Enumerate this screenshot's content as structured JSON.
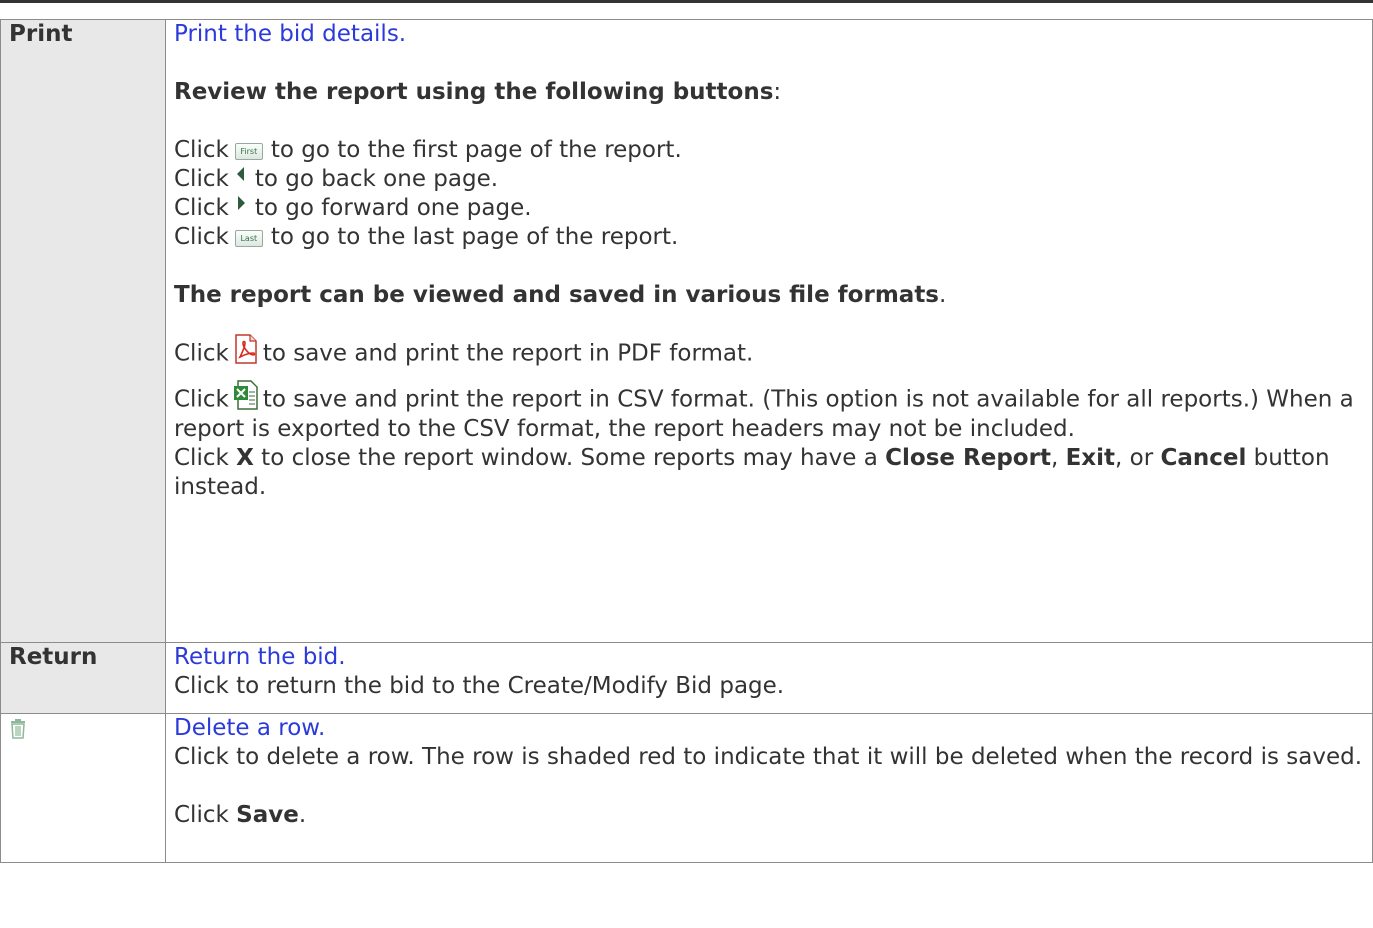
{
  "print": {
    "key_label": "Print",
    "link": "Print the bid details.",
    "review_heading": "Review the report using the following buttons",
    "review_colon": ":",
    "click": "Click",
    "first_btn_text": "First",
    "first_desc": "to go to the first page of the report.",
    "prev_desc": "to go back one page.",
    "next_desc": "to go forward one page.",
    "last_btn_text": "Last",
    "last_desc": "to go to the last page of the report.",
    "formats_heading": "The report can be viewed and saved in various file formats",
    "formats_period": ".",
    "pdf_desc": "to save and print the report in PDF format.",
    "csv_desc": "to save and print the report in CSV format. (This option is not available for all reports.) When a report is exported to the CSV format, the report headers may not be included.",
    "close_pre": "Click ",
    "close_x": "X",
    "close_mid": " to close the report window. Some reports may have a ",
    "close_report": "Close Report",
    "comma1": ", ",
    "exit": "Exit",
    "comma2": ", or ",
    "cancel": "Cancel",
    "close_end": " button instead."
  },
  "return": {
    "key_label": "Return",
    "link": "Return the bid.",
    "desc": "Click to return the bid to the Create/Modify Bid page."
  },
  "delete": {
    "icon": "trash-icon",
    "link": "Delete a row.",
    "desc": "Click to delete a row. The row is shaded red to indicate that it will be deleted when the record is saved.",
    "save_pre": "Click ",
    "save_bold": "Save",
    "save_end": "."
  },
  "colors": {
    "link": "#2b3adb",
    "text": "#333333",
    "border": "#8c8c8c",
    "key_bg": "#e8e8e8"
  }
}
